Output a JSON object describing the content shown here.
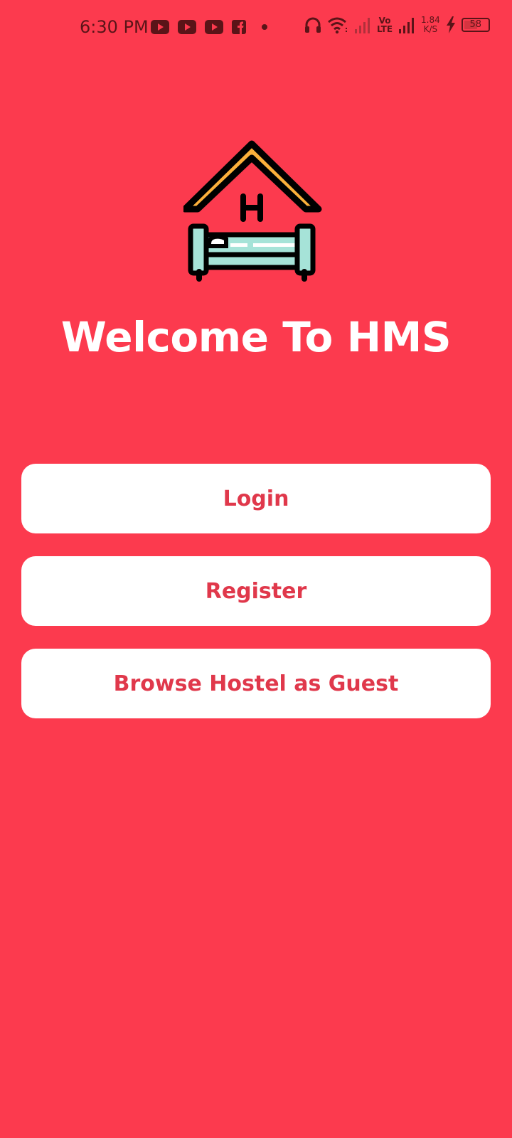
{
  "status_bar": {
    "time": "6:30 PM",
    "notification_icons": [
      "youtube-icon",
      "youtube-icon",
      "youtube-icon",
      "facebook-icon",
      "dot-icon"
    ],
    "volte_line1": "Vo",
    "volte_line2": "LTE",
    "speed_value": "1.84",
    "speed_unit": "K/S",
    "battery_level": "58"
  },
  "colors": {
    "background": "#fc3a4e",
    "button_background": "#ffffff",
    "button_text": "#e0384b",
    "roof": "#fbb03b",
    "bed_sheet": "#a6e3d8"
  },
  "logo": {
    "icon": "hostel-bed-icon",
    "letter": "H"
  },
  "welcome": {
    "title": "Welcome To HMS"
  },
  "buttons": {
    "login": "Login",
    "register": "Register",
    "guest": "Browse Hostel as Guest"
  }
}
